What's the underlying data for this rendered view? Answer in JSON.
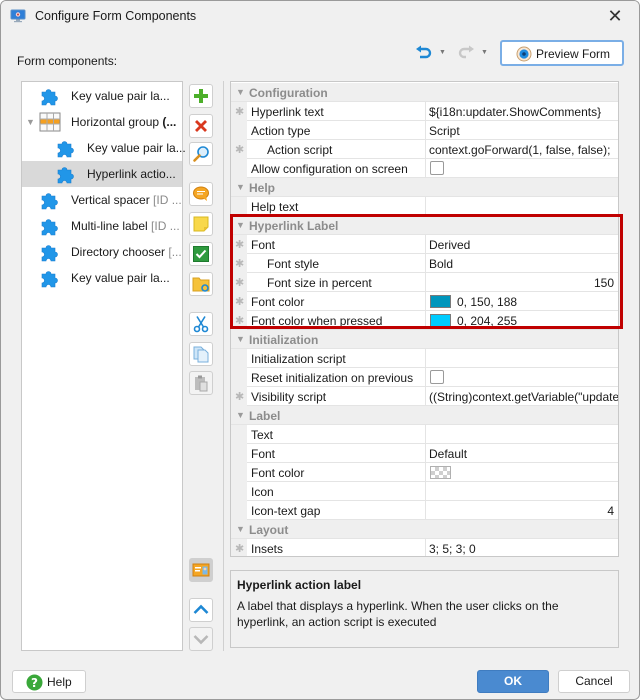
{
  "window": {
    "title": "Configure Form Components",
    "close_icon": "close-icon"
  },
  "left_panel": {
    "label": "Form components:"
  },
  "toolbar": {
    "undo_icon": "undo-icon",
    "redo_icon": "redo-icon",
    "preview_label": "Preview Form"
  },
  "tree": {
    "items": [
      {
        "label": "Key value pair la...",
        "dim": "",
        "icon": "puzzle-icon",
        "level": 0,
        "selected": false
      },
      {
        "label": "Horizontal group (...",
        "dim": "",
        "icon": "horizontal-group-icon",
        "level": 0,
        "selected": false,
        "expanded": true,
        "bold": true
      },
      {
        "label": "Key value pair la...",
        "dim": "",
        "icon": "puzzle-icon",
        "level": 1,
        "selected": false
      },
      {
        "label": "Hyperlink actio...",
        "dim": "",
        "icon": "puzzle-icon",
        "level": 1,
        "selected": true
      },
      {
        "label": "Vertical spacer ",
        "dim": "[ID ...",
        "icon": "puzzle-icon",
        "level": 0,
        "selected": false
      },
      {
        "label": "Multi-line label ",
        "dim": "[ID ...",
        "icon": "puzzle-icon",
        "level": 0,
        "selected": false
      },
      {
        "label": "Directory chooser ",
        "dim": "[...",
        "icon": "puzzle-icon",
        "level": 0,
        "selected": false
      },
      {
        "label": "Key value pair la...",
        "dim": "",
        "icon": "puzzle-icon",
        "level": 0,
        "selected": false
      }
    ]
  },
  "side_buttons": [
    {
      "name": "add-button",
      "icon": "plus-icon"
    },
    {
      "name": "delete-button",
      "icon": "x-icon"
    },
    {
      "name": "search-button",
      "icon": "magnifier-icon"
    },
    {
      "name": "comment-button",
      "icon": "speech-bubble-icon"
    },
    {
      "name": "note-button",
      "icon": "sticky-note-icon"
    },
    {
      "name": "check-button",
      "icon": "checkbox-icon"
    },
    {
      "name": "folder-button",
      "icon": "folder-link-icon"
    },
    {
      "name": "cut-button",
      "icon": "scissors-icon"
    },
    {
      "name": "copy-button",
      "icon": "copy-icon"
    },
    {
      "name": "paste-button",
      "icon": "paste-icon"
    },
    {
      "name": "preview-image-button",
      "icon": "image-card-icon"
    },
    {
      "name": "move-up-button",
      "icon": "chevron-up-icon"
    },
    {
      "name": "move-down-button",
      "icon": "chevron-down-icon"
    }
  ],
  "properties": {
    "categories": [
      {
        "name": "Configuration",
        "rows": [
          {
            "name": "Hyperlink text",
            "value": "${i18n:updater.ShowComments}",
            "star": true,
            "indent": 0
          },
          {
            "name": "Action type",
            "value": "Script",
            "star": false,
            "indent": 0
          },
          {
            "name": "Action script",
            "value": "context.goForward(1, false, false);",
            "star": true,
            "indent": 1
          },
          {
            "name": "Allow configuration on screen",
            "value": "",
            "type": "checkbox",
            "checked": false,
            "star": false,
            "indent": 0
          }
        ]
      },
      {
        "name": "Help",
        "rows": [
          {
            "name": "Help text",
            "value": "",
            "star": false,
            "indent": 0
          }
        ]
      },
      {
        "name": "Hyperlink Label",
        "rows": [
          {
            "name": "Font",
            "value": "Derived",
            "star": true,
            "indent": 0
          },
          {
            "name": "Font style",
            "value": "Bold",
            "star": true,
            "indent": 1
          },
          {
            "name": "Font size in percent",
            "value": "150",
            "star": true,
            "indent": 1,
            "align": "right"
          },
          {
            "name": "Font color",
            "value": "0, 150, 188",
            "type": "color",
            "color": "#0096bc",
            "star": true,
            "indent": 0
          },
          {
            "name": "Font color when pressed",
            "value": "0, 204, 255",
            "type": "color",
            "color": "#00ccff",
            "star": true,
            "indent": 0
          }
        ]
      },
      {
        "name": "Initialization",
        "rows": [
          {
            "name": "Initialization script",
            "value": "",
            "star": false,
            "indent": 0
          },
          {
            "name": "Reset initialization on previous",
            "value": "",
            "type": "checkbox",
            "checked": false,
            "star": false,
            "indent": 0
          },
          {
            "name": "Visibility script",
            "value": "((String)context.getVariable(\"updater.",
            "star": true,
            "indent": 0
          }
        ]
      },
      {
        "name": "Label",
        "rows": [
          {
            "name": "Text",
            "value": "",
            "star": false,
            "indent": 0
          },
          {
            "name": "Font",
            "value": "Default",
            "star": false,
            "indent": 0
          },
          {
            "name": "Font color",
            "value": "",
            "type": "color-empty",
            "star": false,
            "indent": 0
          },
          {
            "name": "Icon",
            "value": "",
            "star": false,
            "indent": 0
          },
          {
            "name": "Icon-text gap",
            "value": "4",
            "star": false,
            "indent": 0,
            "align": "right"
          }
        ]
      },
      {
        "name": "Layout",
        "rows": [
          {
            "name": "Insets",
            "value": "3; 5; 3; 0",
            "star": true,
            "indent": 0
          }
        ]
      }
    ]
  },
  "description": {
    "title": "Hyperlink action label",
    "text": "A label that displays a hyperlink. When the user clicks on the hyperlink, an action script is executed"
  },
  "footer": {
    "help_label": "Help",
    "ok_label": "OK",
    "cancel_label": "Cancel"
  },
  "colors": {
    "accent": "#4a8ad0",
    "highlight_border": "#c00000",
    "selection": "#d9d9d9"
  }
}
